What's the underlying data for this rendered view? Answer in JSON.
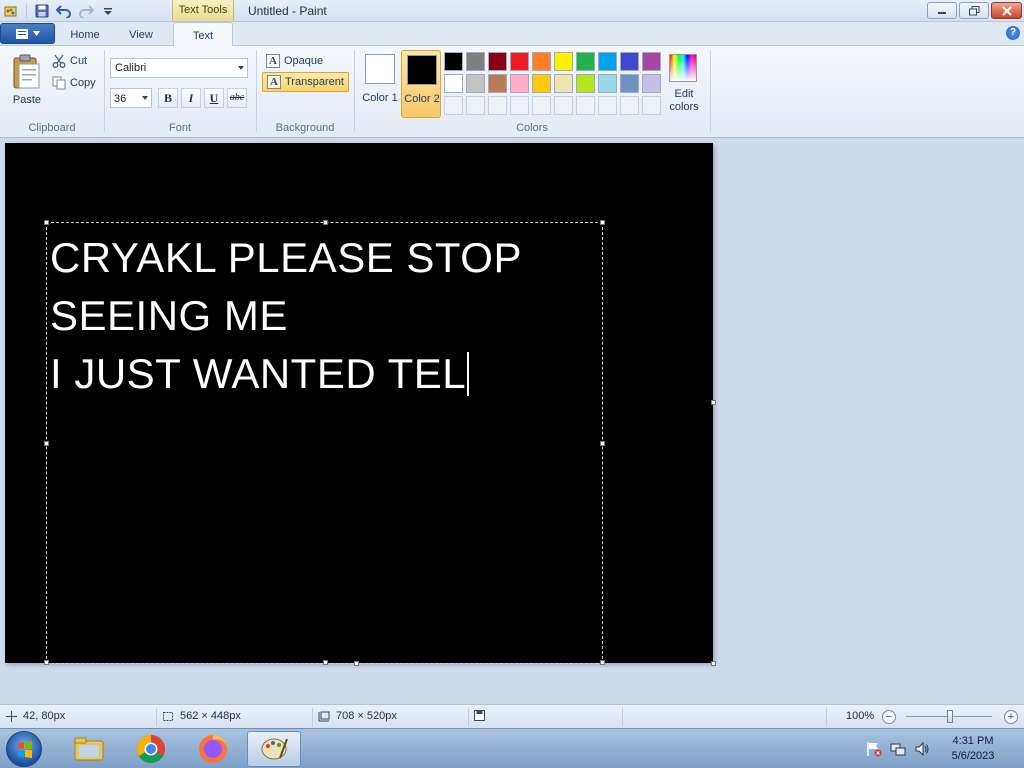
{
  "window": {
    "title": "Untitled - Paint",
    "context_tab": "Text Tools"
  },
  "tabs": {
    "home": "Home",
    "view": "View",
    "text": "Text",
    "help": "?"
  },
  "ribbon": {
    "clipboard": {
      "group_label": "Clipboard",
      "paste": "Paste",
      "cut": "Cut",
      "copy": "Copy"
    },
    "font": {
      "group_label": "Font",
      "family": "Calibri",
      "size": "36",
      "bold": "B",
      "italic": "I",
      "underline": "U",
      "strikethrough": "abc"
    },
    "background": {
      "group_label": "Background",
      "opaque": "Opaque",
      "transparent": "Transparent",
      "selected": "transparent"
    },
    "colors": {
      "group_label": "Colors",
      "color1_label": "Color 1",
      "color1_value": "#ffffff",
      "color2_label": "Color 2",
      "color2_value": "#000000",
      "edit_label": "Edit colors",
      "palette_row1": [
        "#000000",
        "#7f7f7f",
        "#880015",
        "#ed1c24",
        "#ff7f27",
        "#fff200",
        "#22b14c",
        "#00a2e8",
        "#3f48cc",
        "#a349a4"
      ],
      "palette_row2": [
        "#ffffff",
        "#c3c3c3",
        "#b97a57",
        "#ffaec9",
        "#ffc90e",
        "#efe4b0",
        "#b5e61d",
        "#99d9ea",
        "#7092be",
        "#c8bfe7"
      ]
    }
  },
  "canvas": {
    "text_lines": [
      "CRYAKL PLEASE STOP",
      "SEEING ME",
      "I JUST WANTED TEL"
    ]
  },
  "statusbar": {
    "cursor_pos": "42, 80px",
    "selection_size": "562 × 448px",
    "canvas_size": "708 × 520px",
    "zoom": "100%"
  },
  "taskbar": {
    "time": "4:31 PM",
    "date": "5/6/2023"
  }
}
